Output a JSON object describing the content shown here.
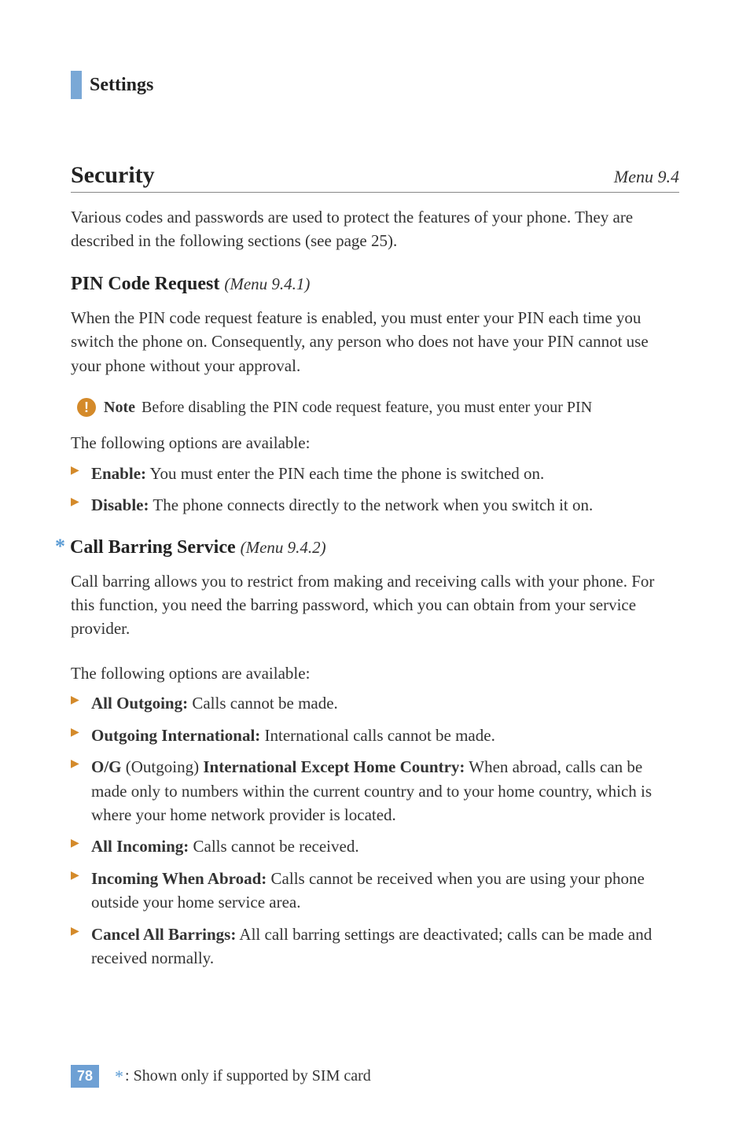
{
  "section": {
    "label": "Settings"
  },
  "title": {
    "main": "Security",
    "menu": "Menu 9.4"
  },
  "intro": "Various codes and passwords are used to protect the features of your phone. They are described in the following sections (see page 25).",
  "pin": {
    "heading": "PIN Code Request",
    "menu": "(Menu 9.4.1)",
    "para": "When the PIN code request feature is enabled, you must enter your PIN each time you switch the phone on. Consequently, any person who does not have your PIN cannot use your phone without your approval.",
    "note_label": "Note",
    "note_text": "Before disabling the PIN code request feature, you must enter your PIN",
    "options_intro": "The following options are available:",
    "options": [
      {
        "label": "Enable:",
        "text": " You must enter the PIN each time the phone is switched on."
      },
      {
        "label": "Disable:",
        "text": " The phone connects directly to the network when you switch it on."
      }
    ]
  },
  "callbar": {
    "star": "*",
    "heading": "Call Barring Service",
    "menu": "(Menu 9.4.2)",
    "para": "Call barring allows you to restrict from making and receiving calls with your phone. For this function, you need the barring password, which you can obtain from your service provider.",
    "options_intro": "The following options are available:",
    "options": [
      {
        "label": "All Outgoing:",
        "text": " Calls cannot be made."
      },
      {
        "label": "Outgoing International:",
        "text": " International calls cannot be made."
      },
      {
        "label": "O/G",
        "mid": " (Outgoing) ",
        "label2": "International Except Home Country:",
        "text": " When abroad, calls can be made only to numbers within the current country and to your home country, which is where your home network provider is located."
      },
      {
        "label": "All Incoming:",
        "text": " Calls cannot be received."
      },
      {
        "label": "Incoming When Abroad:",
        "text": " Calls cannot be received when you are using your phone outside your home service area."
      },
      {
        "label": "Cancel All Barrings:",
        "text": " All call barring settings are deactivated; calls can be made and received normally."
      }
    ]
  },
  "footer": {
    "page": "78",
    "star": "*",
    "note": ": Shown only if supported by SIM card"
  }
}
